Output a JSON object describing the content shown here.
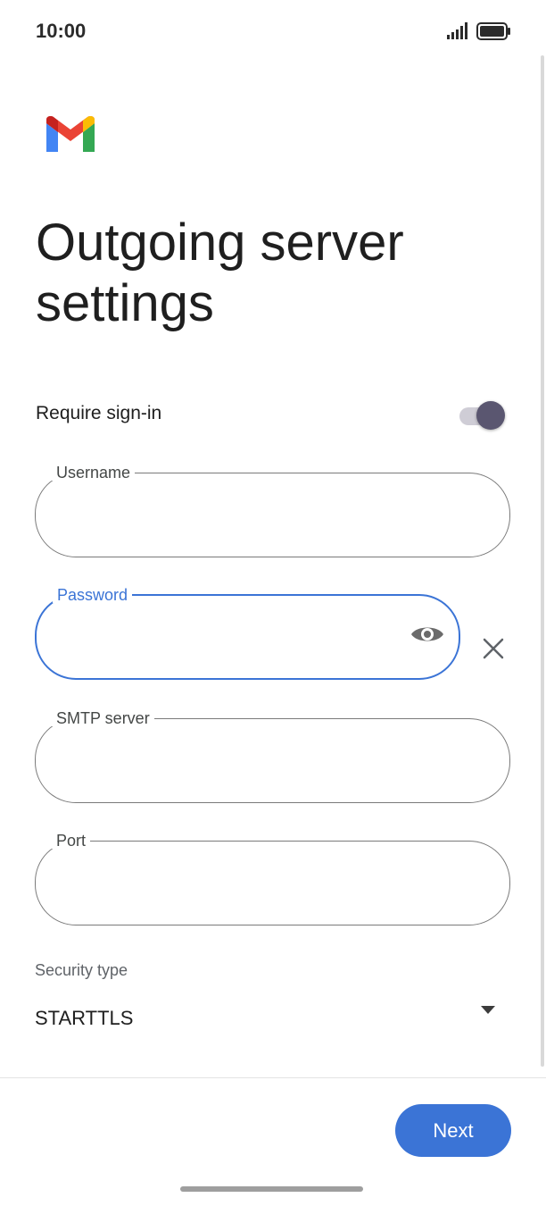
{
  "status_bar": {
    "time": "10:00",
    "icons": [
      "signal-icon",
      "battery-icon"
    ]
  },
  "app": {
    "logo": "gmail-logo"
  },
  "page": {
    "title": "Outgoing server settings"
  },
  "require_signin": {
    "label": "Require sign-in",
    "enabled": true
  },
  "fields": {
    "username": {
      "label": "Username",
      "value": ""
    },
    "password": {
      "label": "Password",
      "value": "",
      "focused": true
    },
    "smtp_server": {
      "label": "SMTP server",
      "value": ""
    },
    "port": {
      "label": "Port",
      "value": ""
    }
  },
  "security": {
    "label": "Security type",
    "value": "STARTTLS"
  },
  "footer": {
    "next_label": "Next"
  },
  "colors": {
    "accent": "#3b74d6",
    "toggle_thumb": "#5a5670",
    "toggle_track": "#cfcdd6",
    "outline": "#7a7a7a"
  }
}
